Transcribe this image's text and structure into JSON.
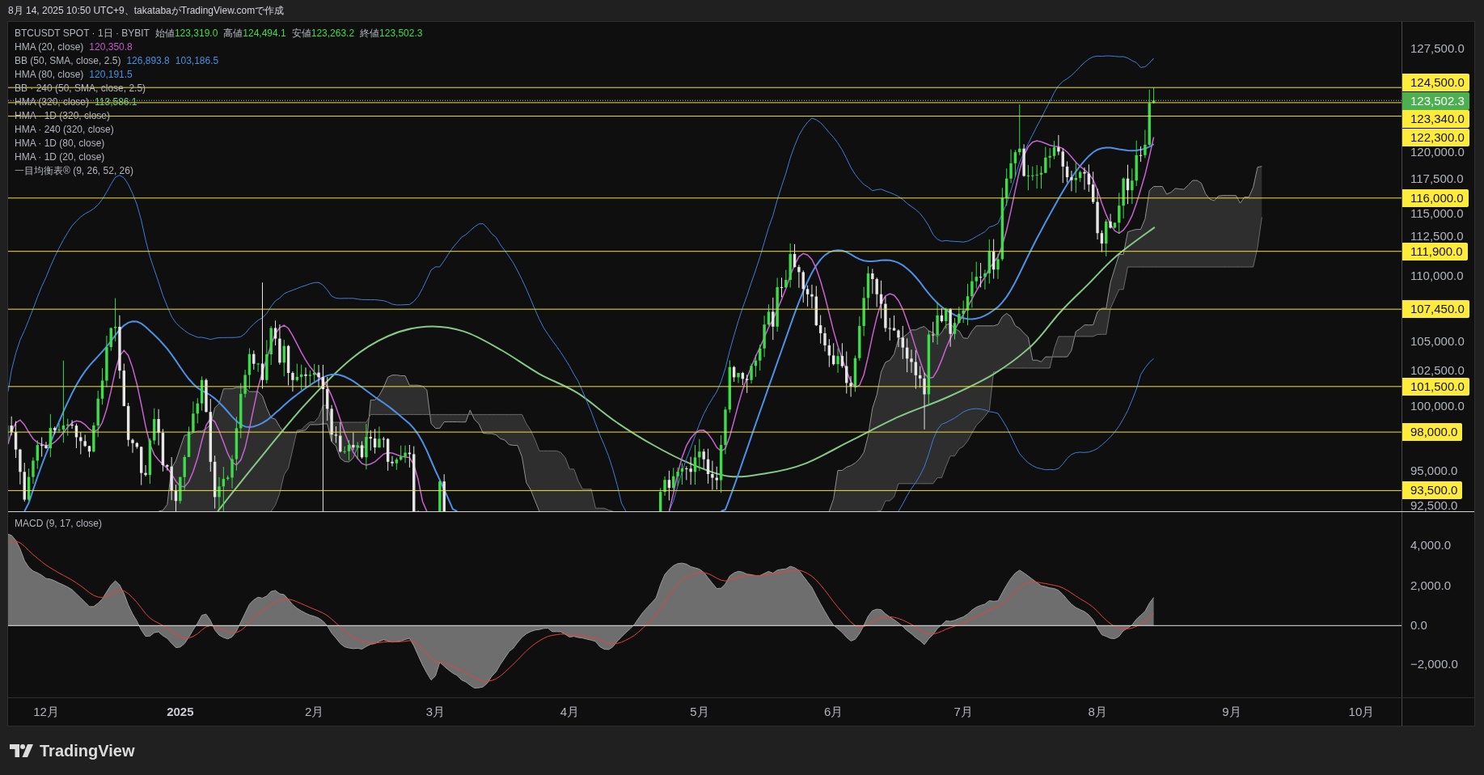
{
  "caption": "8月 14, 2025 10:50 UTC+9、takatabaがTradingView.comで作成",
  "legend": {
    "symbol": "BTCUSDT SPOT · 1日 · BYBIT",
    "ohlc": [
      {
        "label": "始値",
        "value": "123,319.0"
      },
      {
        "label": "高値",
        "value": "124,494.1"
      },
      {
        "label": "安値",
        "value": "123,263.2"
      },
      {
        "label": "終値",
        "value": "123,502.3"
      }
    ],
    "indicators": [
      {
        "name": "HMA (20, close)",
        "color": "#c25ac6",
        "values": [
          "120,350.8"
        ]
      },
      {
        "name": "BB (50, SMA, close, 2.5)",
        "color": "#4a8fe0",
        "values": [
          "126,893.8",
          "103,186.5"
        ]
      },
      {
        "name": "HMA (80, close)",
        "color": "#4a8fe0",
        "values": [
          "120,191.5"
        ]
      },
      {
        "name": "BB · 240 (50, SMA, close, 2.5)"
      },
      {
        "name": "HMA (320, close)",
        "color": "#7cc97c",
        "values": [
          "113,586.1"
        ]
      },
      {
        "name": "HMA · 1D (320, close)"
      },
      {
        "name": "HMA · 240 (320, close)"
      },
      {
        "name": "HMA · 1D (80, close)"
      },
      {
        "name": "HMA · 1D (20, close)"
      },
      {
        "name": "一目均衡表® (9, 26, 52, 26)"
      }
    ]
  },
  "price_axis": {
    "ticks": [
      "127,500.0",
      "120,000.0",
      "117,500.0",
      "115,000.0",
      "112,500.0",
      "110,000.0",
      "105,000.0",
      "102,500.0",
      "100,000.0",
      "95,000.0",
      "92,500.0"
    ],
    "levels": [
      {
        "label": "124,500.0",
        "kind": "level"
      },
      {
        "label": "123,502.3",
        "kind": "last_price"
      },
      {
        "label": "123,340.0",
        "kind": "level"
      },
      {
        "label": "122,300.0",
        "kind": "level"
      },
      {
        "label": "116,000.0",
        "kind": "level"
      },
      {
        "label": "111,900.0",
        "kind": "level"
      },
      {
        "label": "107,450.0",
        "kind": "level"
      },
      {
        "label": "101,500.0",
        "kind": "level"
      },
      {
        "label": "98,000.0",
        "kind": "level"
      },
      {
        "label": "93,500.0",
        "kind": "level"
      }
    ]
  },
  "macd": {
    "title": "MACD (9, 17, close)",
    "ticks": [
      "4,000.0",
      "2,000.0",
      "0.0",
      "−2,000.0"
    ]
  },
  "time_axis": [
    {
      "label": "12月",
      "kind": "month"
    },
    {
      "label": "2025",
      "kind": "year"
    },
    {
      "label": "2月",
      "kind": "month"
    },
    {
      "label": "3月",
      "kind": "month"
    },
    {
      "label": "4月",
      "kind": "month"
    },
    {
      "label": "5月",
      "kind": "month"
    },
    {
      "label": "6月",
      "kind": "month"
    },
    {
      "label": "7月",
      "kind": "month"
    },
    {
      "label": "8月",
      "kind": "month"
    },
    {
      "label": "9月",
      "kind": "month"
    },
    {
      "label": "10月",
      "kind": "month"
    }
  ],
  "brand": "TradingView"
}
